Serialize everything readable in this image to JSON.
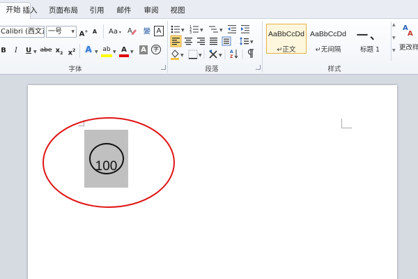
{
  "tabs": [
    "开始",
    "插入",
    "页面布局",
    "引用",
    "邮件",
    "审阅",
    "视图"
  ],
  "font_group": {
    "label": "字体",
    "font_name": "Calibri (西文正",
    "font_size": "一号",
    "grow_font": "A",
    "shrink_font": "A",
    "change_case": "Aa",
    "phonetic": "變",
    "border_char": "A",
    "bold": "B",
    "italic": "I",
    "underline": "U",
    "strikethrough": "abe",
    "subscript": "x",
    "superscript": "x",
    "text_effect": "A",
    "highlight": "ab",
    "font_color": "A",
    "char_shading": "A",
    "enclose_char": "字"
  },
  "paragraph_group": {
    "label": "段落"
  },
  "styles_group": {
    "label": "样式",
    "styles": [
      {
        "sample": "AaBbCcDd",
        "name": "↵正文",
        "selected": true
      },
      {
        "sample": "AaBbCcDd",
        "name": "↵无间隔",
        "selected": false
      },
      {
        "sample": "一、",
        "name": "标题 1",
        "selected": false
      }
    ],
    "change_styles": "更改样"
  },
  "document": {
    "circled_number": "100"
  },
  "colors": {
    "highlight_yellow": "#ffff00",
    "font_red": "#e00000",
    "selection_gray": "#c0c0c0",
    "annotation_red": "#e01414",
    "style_selected_border": "#e3b348"
  }
}
